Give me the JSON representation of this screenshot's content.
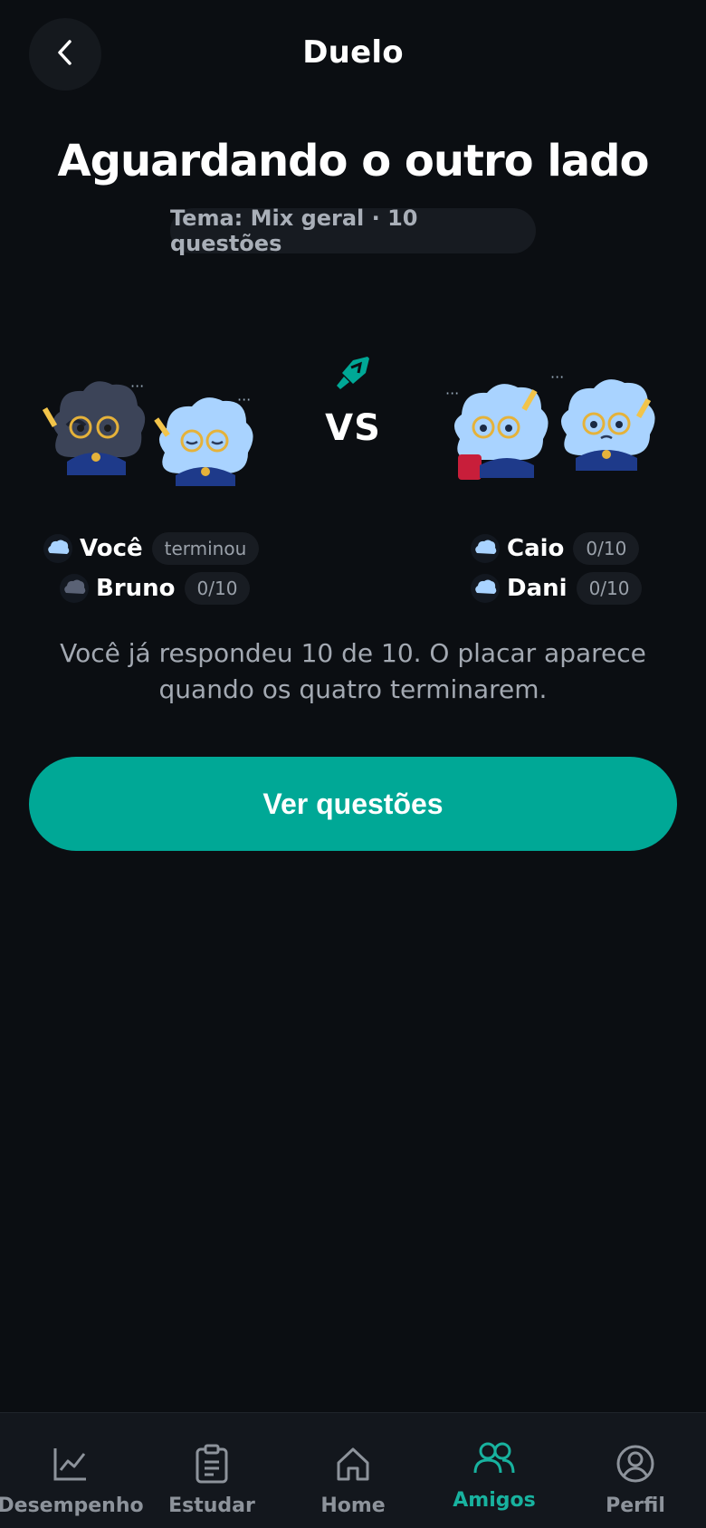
{
  "header": {
    "title": "Duelo",
    "back_icon": "chevron-left-icon"
  },
  "main": {
    "title": "Aguardando o outro lado",
    "topic": "Tema: Mix geral · 10 questões",
    "vs_label": "VS",
    "vs_icon": "sword-icon",
    "info": "Você já respondeu 10 de 10. O placar aparece quando os quatro terminarem.",
    "button_label": "Ver questões"
  },
  "team_left": {
    "players": [
      {
        "name": "Você",
        "status": "terminou"
      },
      {
        "name": "Bruno",
        "status": "0/10"
      }
    ]
  },
  "team_right": {
    "players": [
      {
        "name": "Caio",
        "status": "0/10"
      },
      {
        "name": "Dani",
        "status": "0/10"
      }
    ]
  },
  "nav": {
    "items": [
      {
        "label": "Desempenho",
        "icon": "chart-line-icon"
      },
      {
        "label": "Estudar",
        "icon": "clipboard-icon"
      },
      {
        "label": "Home",
        "icon": "home-icon"
      },
      {
        "label": "Amigos",
        "icon": "users-icon",
        "active": true
      },
      {
        "label": "Perfil",
        "icon": "user-circle-icon"
      }
    ]
  },
  "colors": {
    "background": "#0b0e12",
    "accent": "#00a896",
    "nav_active": "#18b29f"
  }
}
